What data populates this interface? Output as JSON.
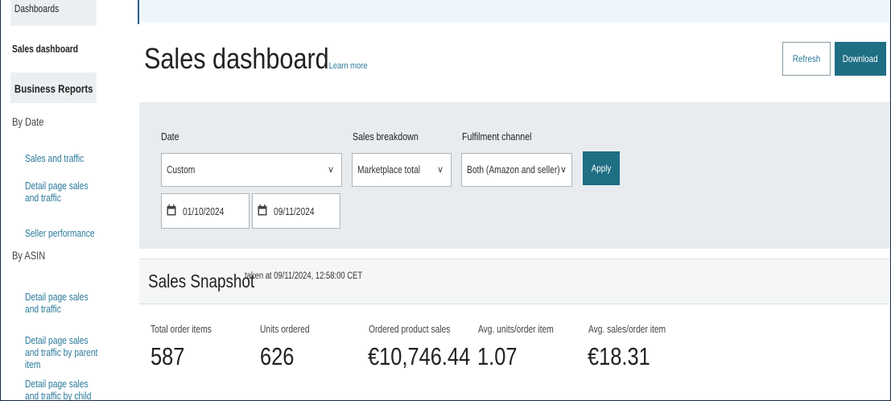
{
  "sidebar": {
    "dashboards": "Dashboards",
    "sales_dashboard": "Sales dashboard",
    "business_reports": "Business Reports",
    "by_date": "By Date",
    "sales_and_traffic": "Sales and traffic",
    "detail_page_sales_traffic": "Detail page sales and traffic",
    "seller_performance": "Seller performance",
    "by_asin": "By ASIN",
    "asin_detail_page": "Detail page sales and traffic",
    "asin_detail_parent": "Detail page sales and traffic by parent item",
    "asin_detail_child": "Detail page sales and traffic by child item"
  },
  "header": {
    "title": "Sales dashboard",
    "learn_more": "Learn more",
    "refresh": "Refresh",
    "download": "Download"
  },
  "filters": {
    "date_label": "Date",
    "date_value": "Custom",
    "breakdown_label": "Sales breakdown",
    "breakdown_value": "Marketplace total",
    "channel_label": "Fulfilment channel",
    "channel_value": "Both (Amazon and seller)",
    "apply": "Apply",
    "start_date": "01/10/2024",
    "end_date": "09/11/2024"
  },
  "snapshot": {
    "title": "Sales Snapshot",
    "taken_at": "taken at 09/11/2024, 12:58:00 CET",
    "metrics": [
      {
        "label": "Total order items",
        "value": "587"
      },
      {
        "label": "Units ordered",
        "value": "626"
      },
      {
        "label": "Ordered product sales",
        "value": "€10,746.44"
      },
      {
        "label": "Avg. units/order item",
        "value": "1.07"
      },
      {
        "label": "Avg. sales/order item",
        "value": "€18.31"
      }
    ]
  },
  "colors": {
    "primary_button": "#1e6e84",
    "link": "#2a7a9a",
    "panel_bg": "#e9ecef"
  }
}
